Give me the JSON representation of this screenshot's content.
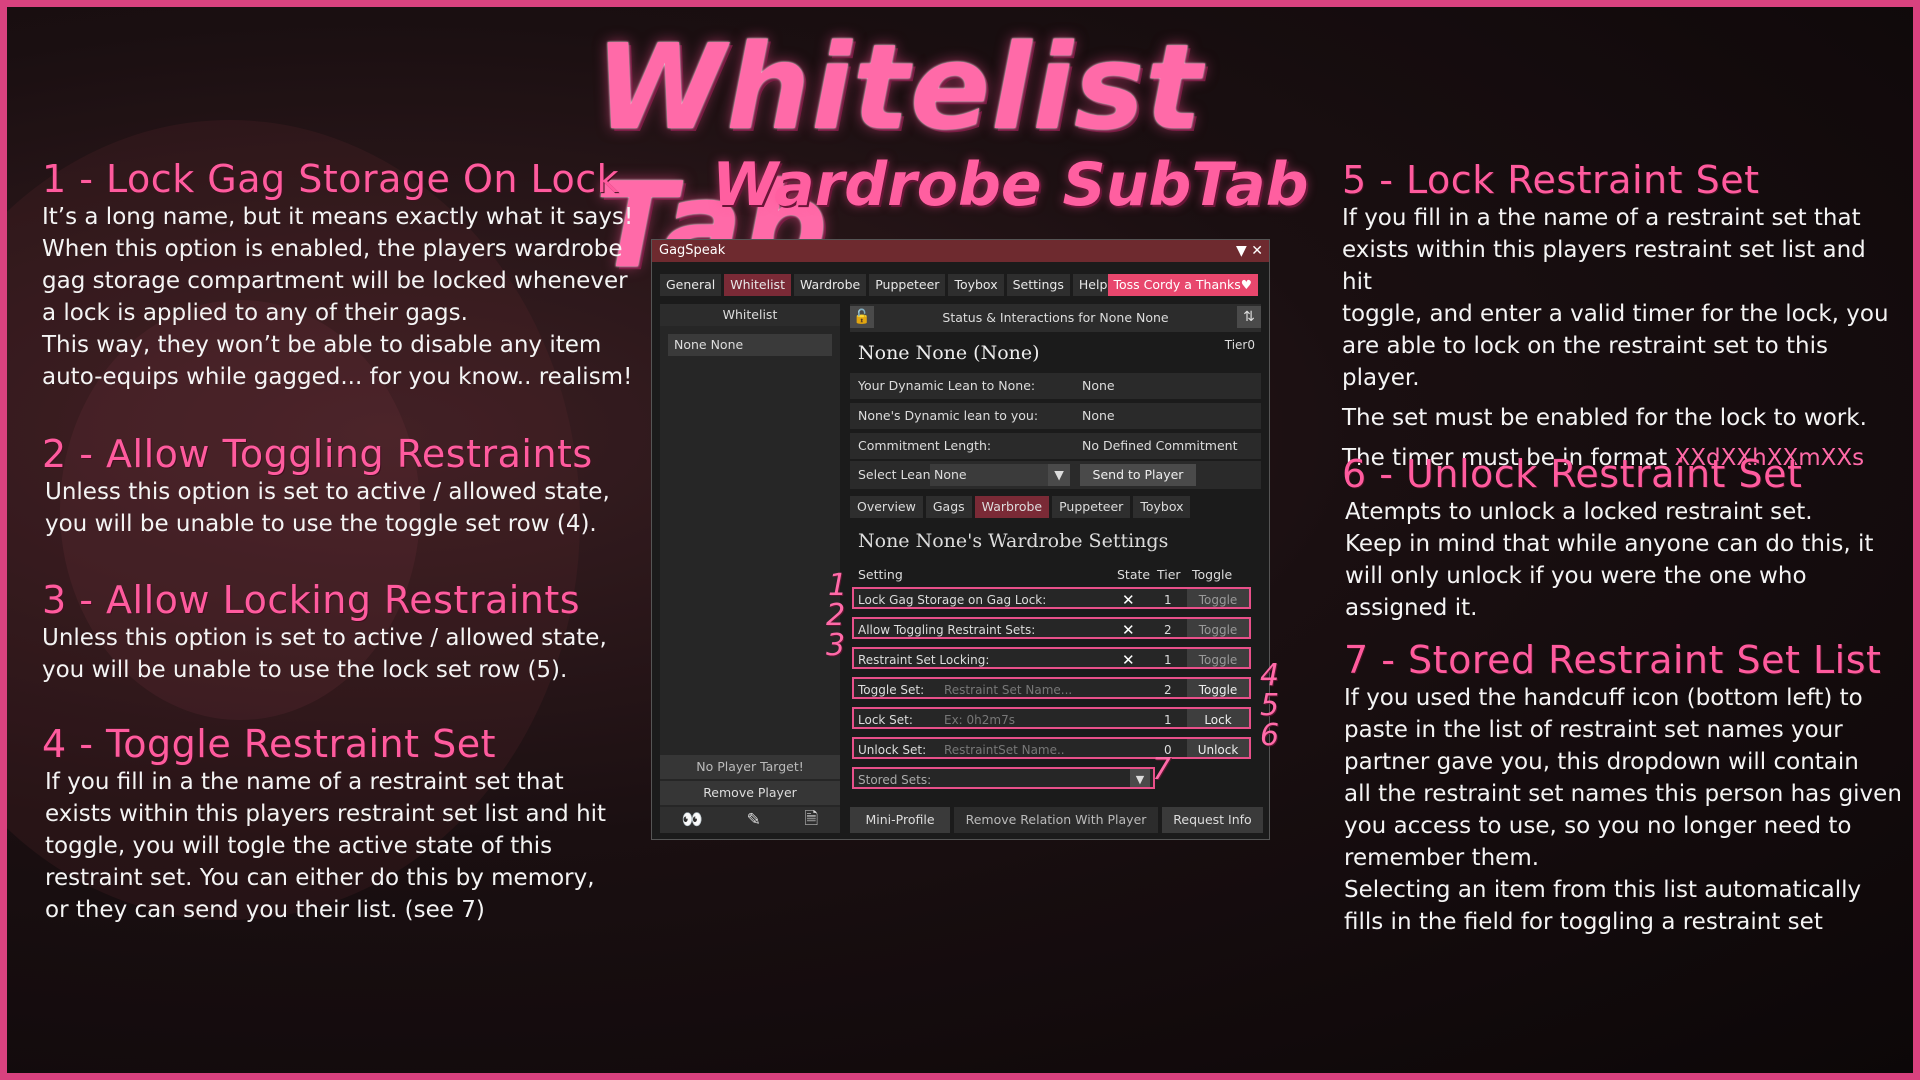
{
  "title": "Whitelist Tab",
  "subtitle": "Wardrobe SubTab",
  "sections": [
    {
      "heading": "1 - Lock Gag Storage On Lock",
      "body": "It’s a long name, but it means exactly what it says!\nWhen this option is enabled, the players wardrobe\ngag storage compartment will be locked whenever\na lock is applied to any of their gags.\nThis way, they won’t be able to disable any item\nauto-equips while gagged... for you know.. realism!"
    },
    {
      "heading": "2 - Allow Toggling Restraints",
      "body": "Unless this option is set to active / allowed state,\nyou will be unable to use the toggle set row (4)."
    },
    {
      "heading": "3 - Allow Locking Restraints",
      "body": "Unless this option is set to active / allowed state,\nyou will be unable to use the lock set row (5)."
    },
    {
      "heading": "4 - Toggle Restraint Set",
      "body": "If you fill in a the name of a restraint set that\nexists within this players restraint set list and hit\ntoggle, you will togle the active state of this\nrestraint set. You can either do this by memory,\nor they can send you their list. (see 7)"
    },
    {
      "heading": "5 - Lock Restraint Set",
      "body": "If you fill in a the name of a restraint set that\nexists within this players restraint set list and hit\ntoggle, and enter a valid timer for the lock, you\nare able to lock on the restraint set to this\nplayer.",
      "body2": "The set must be enabled for the lock to work.",
      "body3_prefix": "The timer must be in format ",
      "body3_hl": "XXdXXhXXmXXs"
    },
    {
      "heading": "6 - Unlock Restraint Set",
      "body": "Atempts to unlock a locked restraint set.\nKeep in mind that while anyone can do this, it\nwill only unlock if you were the one who\nassigned it."
    },
    {
      "heading": "7 - Stored Restraint Set List",
      "body": "If you used the handcuff icon (bottom left) to\npaste in the list of restraint set names your\npartner gave you, this dropdown will contain\nall the restraint set names this person has given\nyou access to use, so you no longer need to\nremember them.\nSelecting an item from this list automatically\nfills in the field for toggling a restraint set"
    }
  ],
  "window": {
    "title": "GagSpeak",
    "controls": "▼ ✕",
    "tabs": [
      "General",
      "Whitelist",
      "Wardrobe",
      "Puppeteer",
      "Toybox",
      "Settings",
      "Help"
    ],
    "thanks_button": "Toss Cordy a Thanks♥",
    "left": {
      "header": "Whitelist",
      "selected_item": "None None",
      "no_target": "No Player Target!",
      "remove_player": "Remove Player",
      "icons": [
        "binoculars-icon",
        "edit-icon",
        "paste-icon"
      ]
    },
    "right": {
      "header": "Status & Interactions for None None",
      "tier": "Tier0",
      "name": "None None (None)",
      "rows": [
        {
          "k": "Your Dynamic Lean to None:",
          "v": "None"
        },
        {
          "k": "None's Dynamic lean to you:",
          "v": "None"
        },
        {
          "k": "Commitment Length:",
          "v": "No Defined Commitment"
        }
      ],
      "select_label": "Select Lean:",
      "select_value": "None",
      "send_button": "Send to Player",
      "subtabs": [
        "Overview",
        "Gags",
        "Warbrobe",
        "Puppeteer",
        "Toybox"
      ],
      "wardrobe_title": "None None's Wardrobe Settings",
      "col_setting": "Setting",
      "col_state": "State",
      "col_tier": "Tier",
      "col_toggle": "Toggle",
      "settings": [
        {
          "label": "Lock Gag Storage on Gag Lock:",
          "state": "✕",
          "tier": "1",
          "btn": "Toggle"
        },
        {
          "label": "Allow Toggling Restraint Sets:",
          "state": "✕",
          "tier": "2",
          "btn": "Toggle"
        },
        {
          "label": "Restraint Set Locking:",
          "state": "✕",
          "tier": "1",
          "btn": "Toggle"
        }
      ],
      "actions": [
        {
          "label": "Toggle Set:",
          "placeholder": "Restraint Set Name...",
          "tier": "2",
          "btn": "Toggle"
        },
        {
          "label": "Lock Set:",
          "placeholder": "Ex: 0h2m7s",
          "tier": "1",
          "btn": "Lock"
        },
        {
          "label": "Unlock Set:",
          "placeholder": "RestraintSet Name..",
          "tier": "0",
          "btn": "Unlock"
        }
      ],
      "stored_label": "Stored Sets:",
      "footer": [
        "Mini-Profile",
        "Remove Relation With Player",
        "Request Info"
      ]
    },
    "markers": [
      "1",
      "2",
      "3",
      "4",
      "5",
      "6",
      "7"
    ]
  },
  "colors": {
    "accent": "#ff5b9e",
    "frame": "#d9427f",
    "tab_active": "#7a2a36",
    "thanks": "#e8476d"
  }
}
